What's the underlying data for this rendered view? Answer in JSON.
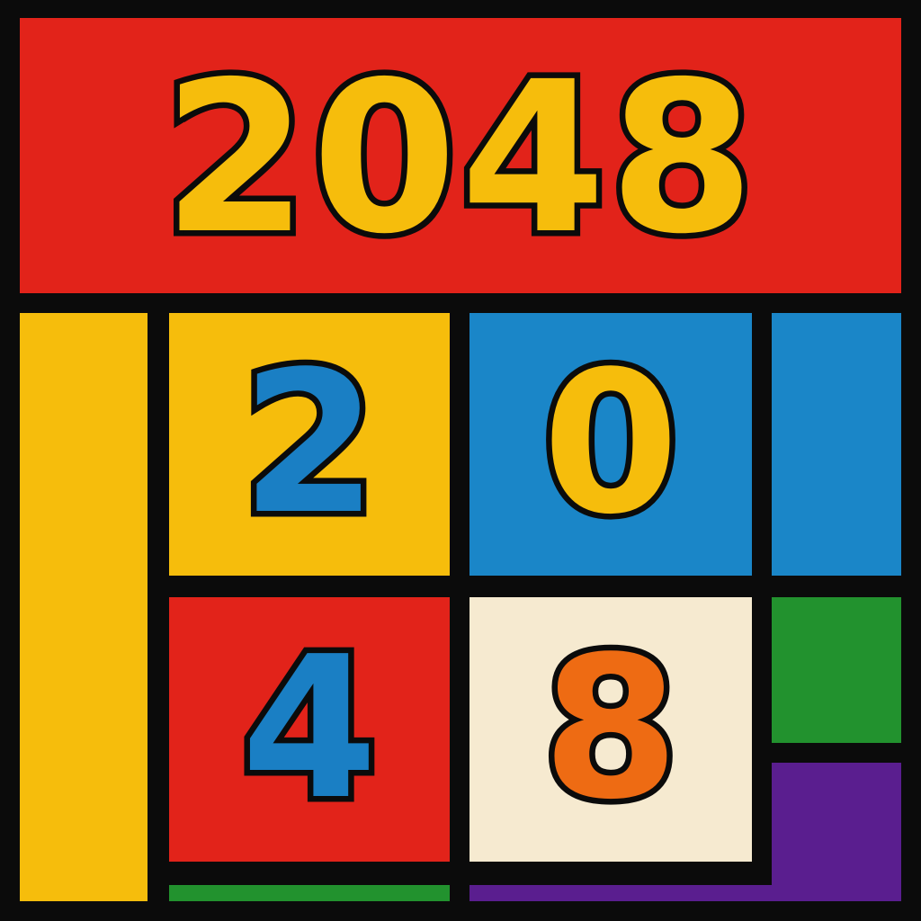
{
  "title": {
    "text": "2048"
  },
  "tiles": [
    {
      "value": "2",
      "digit_color": "#1a7fc4",
      "bg": "#f6bd0c"
    },
    {
      "value": "0",
      "digit_color": "#f6bd0c",
      "bg": "#1a86c8"
    },
    {
      "value": "4",
      "digit_color": "#1a7fc4",
      "bg": "#e2231a"
    },
    {
      "value": "8",
      "digit_color": "#ee6b13",
      "bg": "#f6ead0"
    }
  ],
  "colors": {
    "outline": "#0b0b0b",
    "red": "#e2231a",
    "yellow": "#f6bd0c",
    "blue": "#1a86c8",
    "green": "#22922e",
    "purple": "#5a1e8f",
    "cream": "#f6ead0",
    "orange": "#ee6b13"
  }
}
